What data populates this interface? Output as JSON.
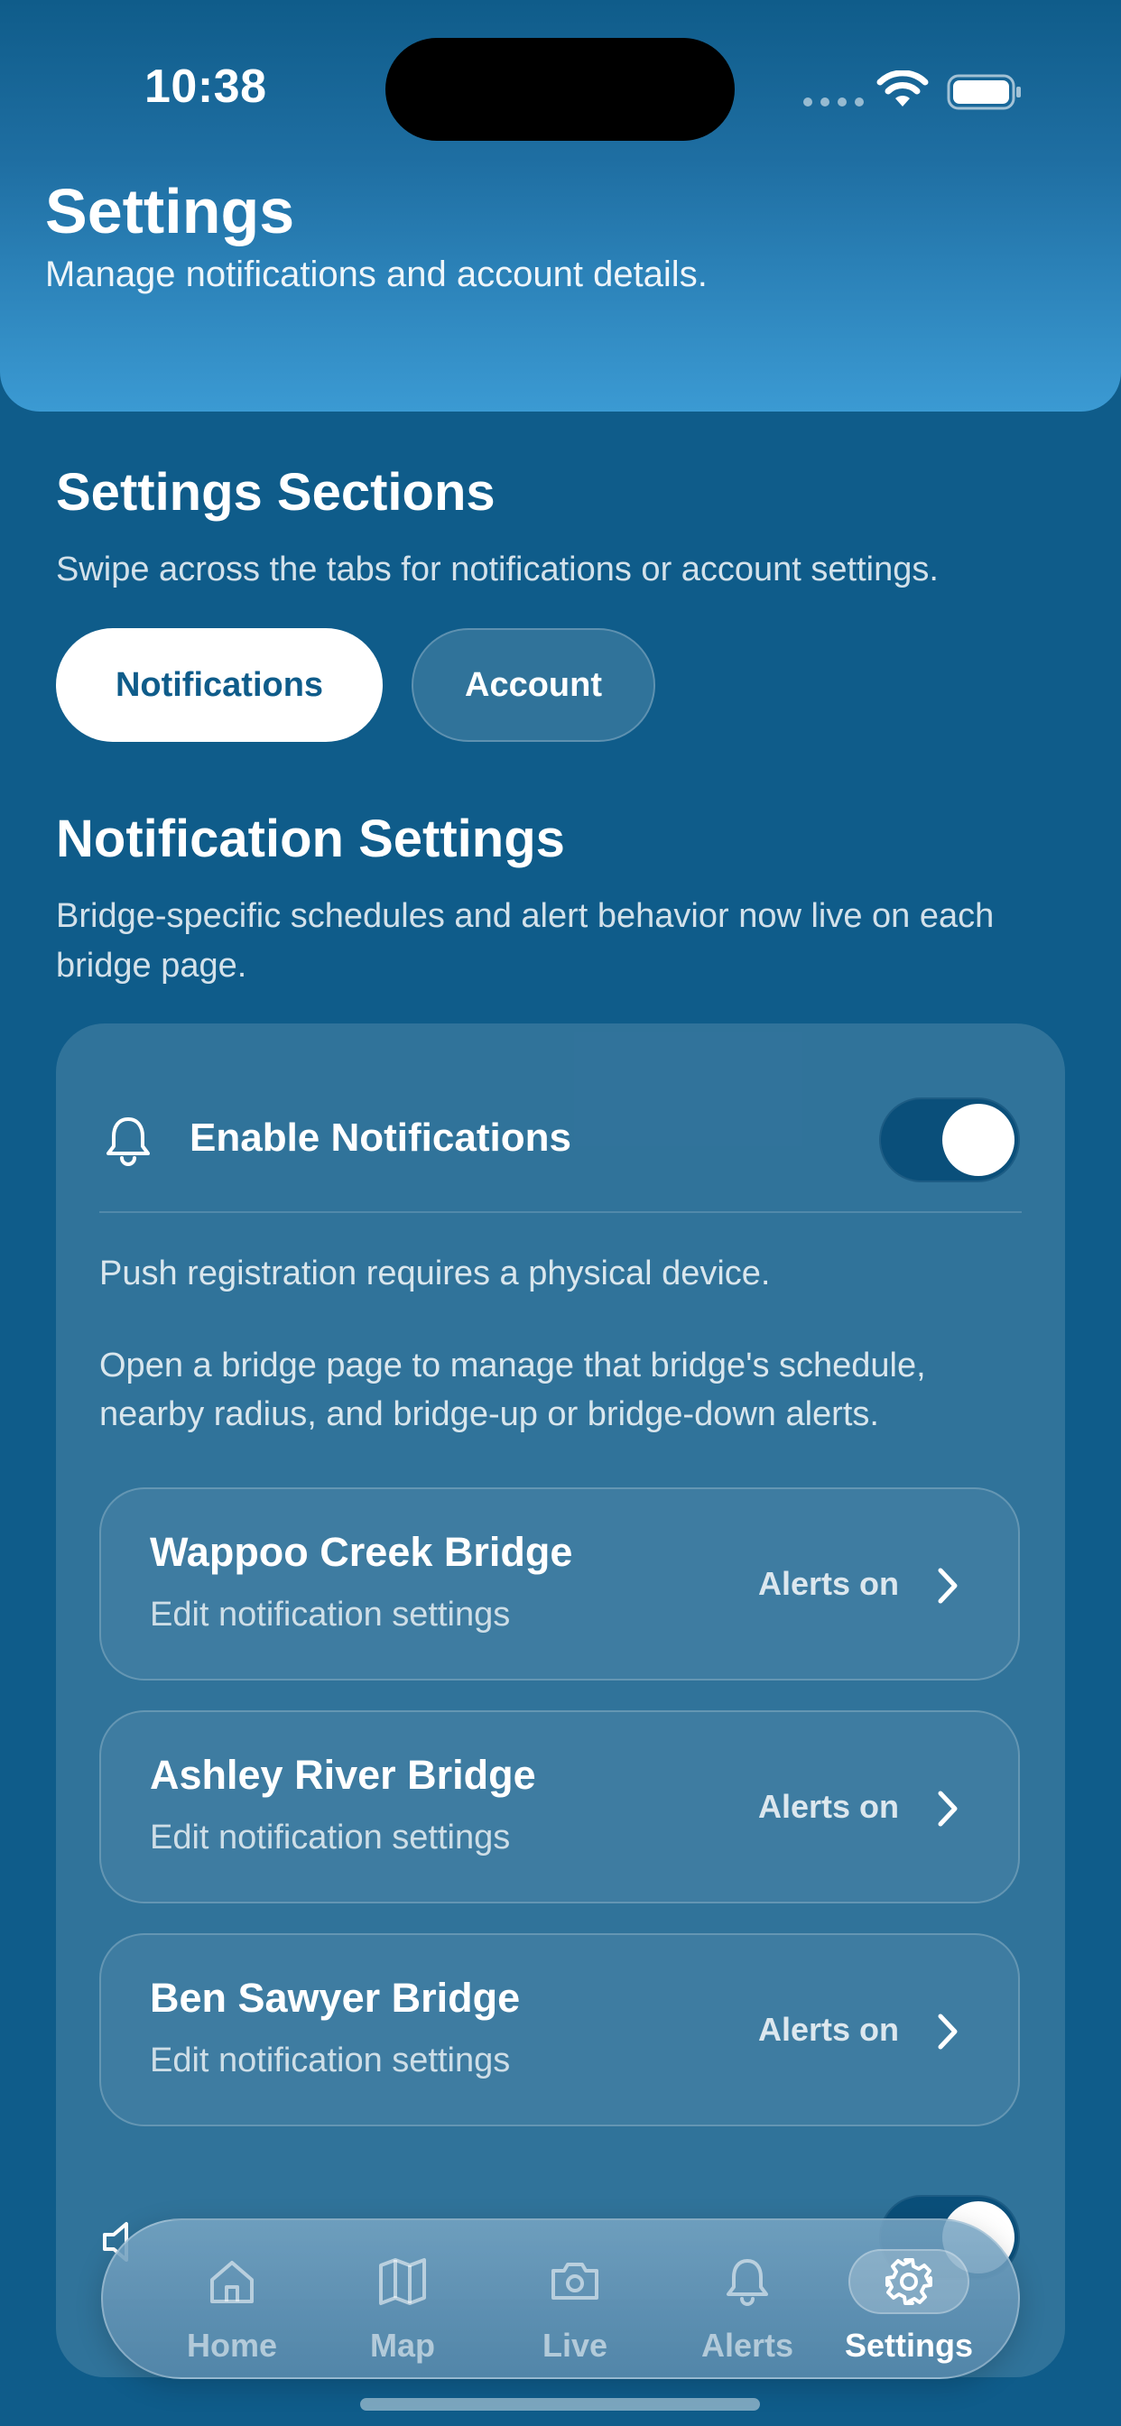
{
  "status_bar": {
    "time": "10:38"
  },
  "header": {
    "title": "Settings",
    "subtitle": "Manage notifications and account details."
  },
  "sections": {
    "title": "Settings Sections",
    "description": "Swipe across the tabs for notifications or account settings.",
    "tabs": [
      {
        "label": "Notifications",
        "selected": true
      },
      {
        "label": "Account",
        "selected": false
      }
    ]
  },
  "notifications": {
    "title": "Notification Settings",
    "description": "Bridge-specific schedules and alert behavior now live on each bridge page.",
    "enable_label": "Enable Notifications",
    "enabled": true,
    "info_device": "Push registration requires a physical device.",
    "info_bridge": "Open a bridge page to manage that bridge's schedule, nearby radius, and bridge-up or bridge-down alerts.",
    "bridges": [
      {
        "name": "Wappoo Creek Bridge",
        "subtitle": "Edit notification settings",
        "status": "Alerts on"
      },
      {
        "name": "Ashley River Bridge",
        "subtitle": "Edit notification settings",
        "status": "Alerts on"
      },
      {
        "name": "Ben Sawyer Bridge",
        "subtitle": "Edit notification settings",
        "status": "Alerts on"
      }
    ],
    "second_toggle_enabled": true
  },
  "tab_bar": {
    "items": [
      {
        "label": "Home",
        "icon": "home-icon",
        "active": false
      },
      {
        "label": "Map",
        "icon": "map-icon",
        "active": false
      },
      {
        "label": "Live",
        "icon": "camera-icon",
        "active": false
      },
      {
        "label": "Alerts",
        "icon": "bell-icon",
        "active": false
      },
      {
        "label": "Settings",
        "icon": "gear-icon",
        "active": true
      }
    ]
  },
  "colors": {
    "background": "#0f5c8a",
    "header_gradient_end": "#3b9ad3",
    "toggle_track": "#0a4f7a",
    "selected_tab_text": "#0f5c8a"
  }
}
